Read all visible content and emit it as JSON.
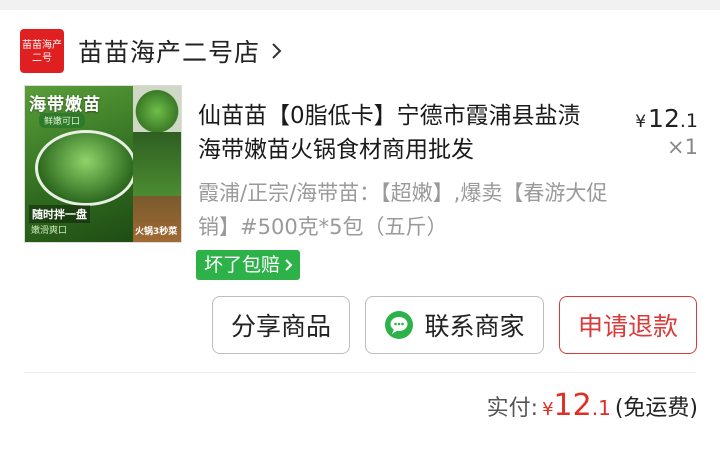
{
  "store": {
    "logo_line1": "苗苗海产",
    "logo_line2": "二号",
    "name": "苗苗海产二号店",
    "icon": "chevron-right-icon"
  },
  "product": {
    "thumbnail": {
      "banner": "海带嫩苗",
      "sub": "鲜嫩可口",
      "caption1": "随时拌一盘",
      "caption2": "嫩滑爽口",
      "side_label": "火锅3秒菜"
    },
    "title": "仙苗苗【0脂低卡】宁德市霞浦县盐渍海带嫩苗火锅食材商用批发",
    "price_symbol": "¥",
    "price_int": "12",
    "price_dec": ".1",
    "quantity": "×1",
    "spec": "霞浦/正宗/海带苗：【超嫩】,爆卖【春游大促销】#500克*5包（五斤）",
    "guarantee_badge": "坏了包赔",
    "guarantee_icon": "chevron-right-icon"
  },
  "actions": {
    "share": "分享商品",
    "contact": "联系商家",
    "contact_icon": "wechat-chat-icon",
    "refund": "申请退款"
  },
  "summary": {
    "label": "实付:",
    "symbol": "¥",
    "amount_int": "12",
    "amount_dec": ".1",
    "shipping": "(免运费)"
  },
  "colors": {
    "store_logo": "#e02020",
    "badge_green": "#2db24a",
    "refund_red": "#d93a3a",
    "price_red": "#e02e24"
  }
}
